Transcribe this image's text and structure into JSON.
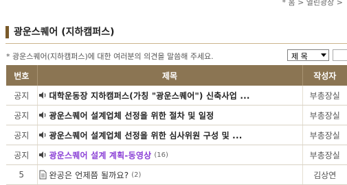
{
  "breadcrumb": "* 홈 > 열린광장 >",
  "page": {
    "title": "광운스퀘어 (지하캠퍼스)",
    "description": "* 광운스퀘어(지하캠퍼스)에 대한 여러분의 의견을 말씀해 주세요."
  },
  "search": {
    "field_value": "제 목"
  },
  "table": {
    "headers": {
      "num": "번호",
      "subject": "제목",
      "author": "작성자"
    },
    "rows": [
      {
        "num": "공지",
        "title": "대학운동장 지하캠퍼스(가칭 \"광운스퀘어\") 신축사업 ...",
        "count": "",
        "author": "부총장실",
        "icon": "speaker-icon",
        "style": "bold"
      },
      {
        "num": "공지",
        "title": "광운스퀘어 설계업체 선정을 위한 절차 및 일정",
        "count": "",
        "author": "부총장실",
        "icon": "speaker-icon",
        "style": "bold"
      },
      {
        "num": "공지",
        "title": "광운스퀘어 설계업체 선정을 위한 심사위원 구성 및 ...",
        "count": "",
        "author": "부총장실",
        "icon": "speaker-icon",
        "style": "bold"
      },
      {
        "num": "공지",
        "title": "광운스퀘어 설계 계획-동영상",
        "count": "(16)",
        "author": "부총장실",
        "icon": "speaker-icon",
        "style": "purple"
      },
      {
        "num": "5",
        "title": "완공은 언제쯤 될까요?",
        "count": "(2)",
        "author": "김상연",
        "icon": "document-icon",
        "style": "normal"
      }
    ]
  },
  "colors": {
    "header_bg": "#8b7553",
    "accent": "#7a5a2a",
    "visited_link": "#8a3fd6"
  }
}
